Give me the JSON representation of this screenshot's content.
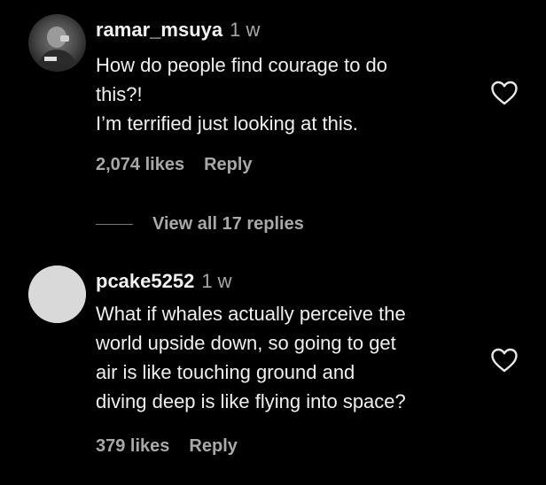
{
  "comments": [
    {
      "username": "ramar_msuya",
      "time": "1 w",
      "lines": [
        "How do people find courage to do",
        "this?!",
        "I’m terrified just looking at this."
      ],
      "likes": "2,074 likes",
      "reply": "Reply",
      "avatar_icon": "user-photo-avatar",
      "like_icon": "heart-outline-icon"
    },
    {
      "username": "pcake5252",
      "time": "1 w",
      "lines": [
        "What if whales actually perceive the",
        "world upside down, so going to get",
        "air is like touching ground and",
        "diving deep is like flying into space?"
      ],
      "likes": "379 likes",
      "reply": "Reply",
      "avatar_icon": "default-avatar",
      "like_icon": "heart-outline-icon"
    }
  ],
  "view_replies": "View all 17 replies",
  "colors": {
    "background": "#000000",
    "primary_text": "#f5f5f5",
    "secondary_text": "#a8a8a8"
  }
}
